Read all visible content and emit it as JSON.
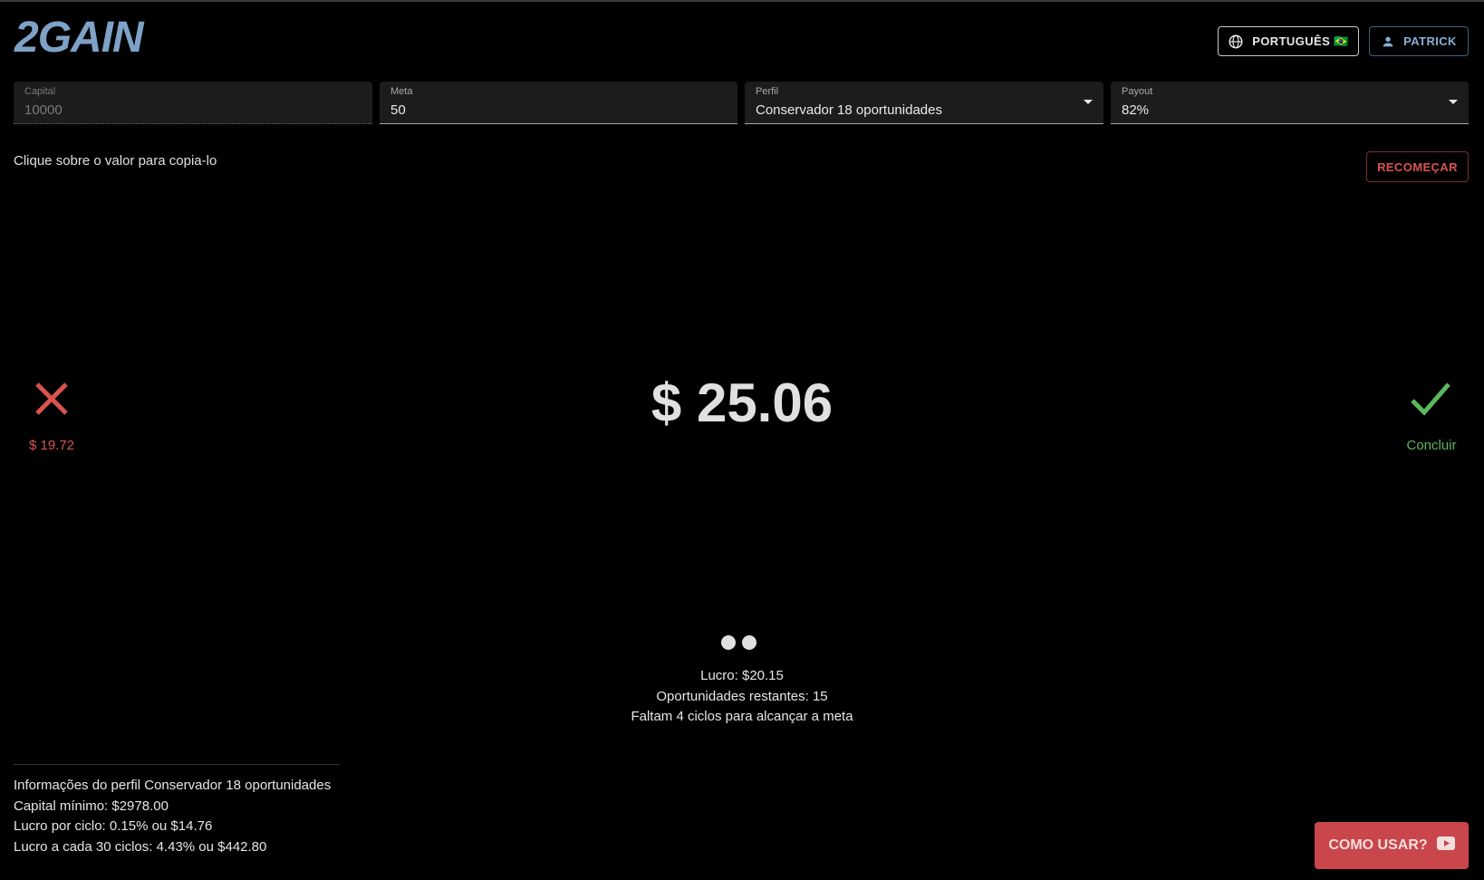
{
  "header": {
    "logo": "2GAIN",
    "language_button": "PORTUGUÊS 🇧🇷",
    "user_button": "PATRICK"
  },
  "fields": {
    "capital": {
      "label": "Capital",
      "value": "10000"
    },
    "meta": {
      "label": "Meta",
      "value": "50"
    },
    "perfil": {
      "label": "Perfil",
      "value": "Conservador 18 oportunidades"
    },
    "payout": {
      "label": "Payout",
      "value": "82%"
    }
  },
  "hint": "Clique sobre o valor para copia-lo",
  "restart_button": "RECOMEÇAR",
  "loss": {
    "value": "$ 19.72",
    "color": "#d9534f"
  },
  "main_value": "$ 25.06",
  "done": {
    "label": "Concluir",
    "color": "#5cb85c"
  },
  "progress_dots": 2,
  "stats": {
    "profit": "Lucro: $20.15",
    "remaining": "Oportunidades restantes: 15",
    "cycles": "Faltam 4 ciclos para alcançar a meta"
  },
  "profile_info": {
    "title": "Informações do perfil Conservador 18 oportunidades",
    "min_capital": "Capital mínimo: $2978.00",
    "profit_per_cycle": "Lucro por ciclo: 0.15% ou $14.76",
    "profit_30_cycles": "Lucro a cada 30 ciclos: 4.43% ou $442.80"
  },
  "howto_button": "COMO USAR?",
  "icons": [
    "globe-icon",
    "person-icon",
    "close-icon",
    "check-icon",
    "youtube-icon"
  ],
  "colors": {
    "accent": "#7ea2c7",
    "danger": "#d9534f",
    "success": "#5cb85c",
    "howto_bg": "#c9464a"
  }
}
